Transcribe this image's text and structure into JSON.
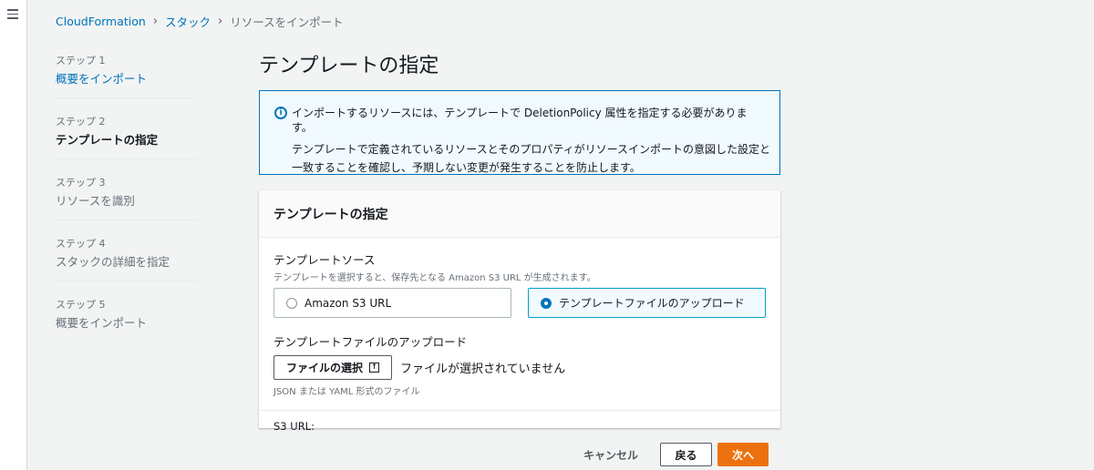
{
  "breadcrumb": {
    "items": [
      "CloudFormation",
      "スタック"
    ],
    "current": "リソースをインポート"
  },
  "steps": [
    {
      "num": "ステップ 1",
      "label": "概要をインポート",
      "state": "link"
    },
    {
      "num": "ステップ 2",
      "label": "テンプレートの指定",
      "state": "active"
    },
    {
      "num": "ステップ 3",
      "label": "リソースを識別",
      "state": "disabled"
    },
    {
      "num": "ステップ 4",
      "label": "スタックの詳細を指定",
      "state": "disabled"
    },
    {
      "num": "ステップ 5",
      "label": "概要をインポート",
      "state": "disabled"
    }
  ],
  "page_title": "テンプレートの指定",
  "alert": {
    "icon": "info-icon",
    "line1": "インポートするリソースには、テンプレートで DeletionPolicy 属性を指定する必要があります。",
    "line2": "テンプレートで定義されているリソースとそのプロパティがリソースインポートの意図した設定と一致することを確認し、予期しない変更が発生することを防止します。"
  },
  "panel": {
    "title": "テンプレートの指定",
    "source_label": "テンプレートソース",
    "source_desc": "テンプレートを選択すると、保存先となる Amazon S3 URL が生成されます。",
    "options": [
      {
        "label": "Amazon S3 URL",
        "selected": false
      },
      {
        "label": "テンプレートファイルのアップロード",
        "selected": true
      }
    ],
    "upload_label": "テンプレートファイルのアップロード",
    "file_button": "ファイルの選択",
    "no_file": "ファイルが選択されていません",
    "file_hint": "JSON または YAML 形式のファイル",
    "s3_url_label": "S3 URL:"
  },
  "actions": {
    "cancel": "キャンセル",
    "back": "戻る",
    "next": "次へ"
  },
  "colors": {
    "accent": "#0073bb",
    "primary_button": "#ec7211",
    "selected_tile_border": "#00a1c9"
  }
}
